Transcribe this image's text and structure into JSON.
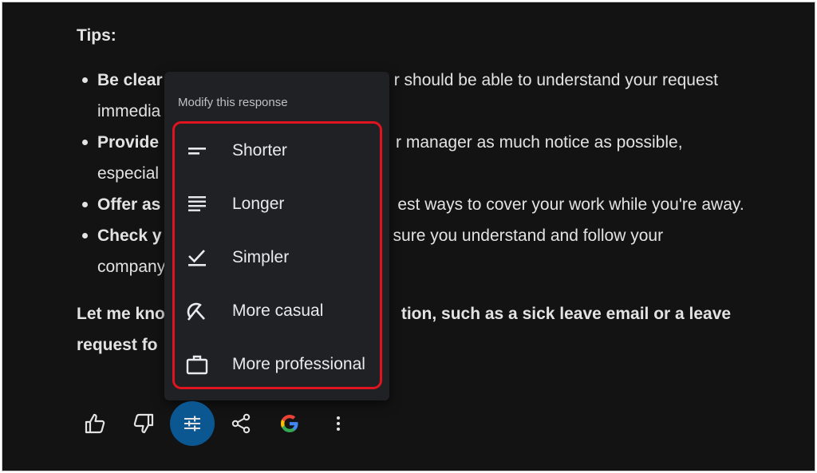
{
  "response": {
    "tips_heading": "Tips:",
    "bullets": [
      {
        "bold": "Be clear",
        "line1_visible": "r should be able to understand your request",
        "line2_visible": "immedia"
      },
      {
        "bold": "Provide",
        "line1_visible": "r manager as much notice as possible,",
        "line2_visible": "especial"
      },
      {
        "bold": "Offer as",
        "line1_visible": "est ways to cover your work while you're away."
      },
      {
        "bold": "Check y",
        "line1_visible": "sure you understand and follow your",
        "line2_visible": "company"
      }
    ],
    "closing_line1_left": "Let me kno",
    "closing_line1_right": "tion, such as a sick leave email or a leave",
    "closing_line2": "request fo"
  },
  "modify_menu": {
    "title": "Modify this response",
    "items": [
      {
        "label": "Shorter",
        "icon": "short-text-icon"
      },
      {
        "label": "Longer",
        "icon": "long-text-icon"
      },
      {
        "label": "Simpler",
        "icon": "check-underline-icon"
      },
      {
        "label": "More casual",
        "icon": "casual-icon"
      },
      {
        "label": "More professional",
        "icon": "briefcase-icon"
      }
    ],
    "highlight_color": "#e0141e"
  },
  "action_bar": {
    "buttons": [
      "thumb-up-icon",
      "thumb-down-icon",
      "tune-icon",
      "share-icon",
      "google-icon",
      "more-vert-icon"
    ],
    "active_button": "tune-icon",
    "active_color": "#0b5791"
  }
}
